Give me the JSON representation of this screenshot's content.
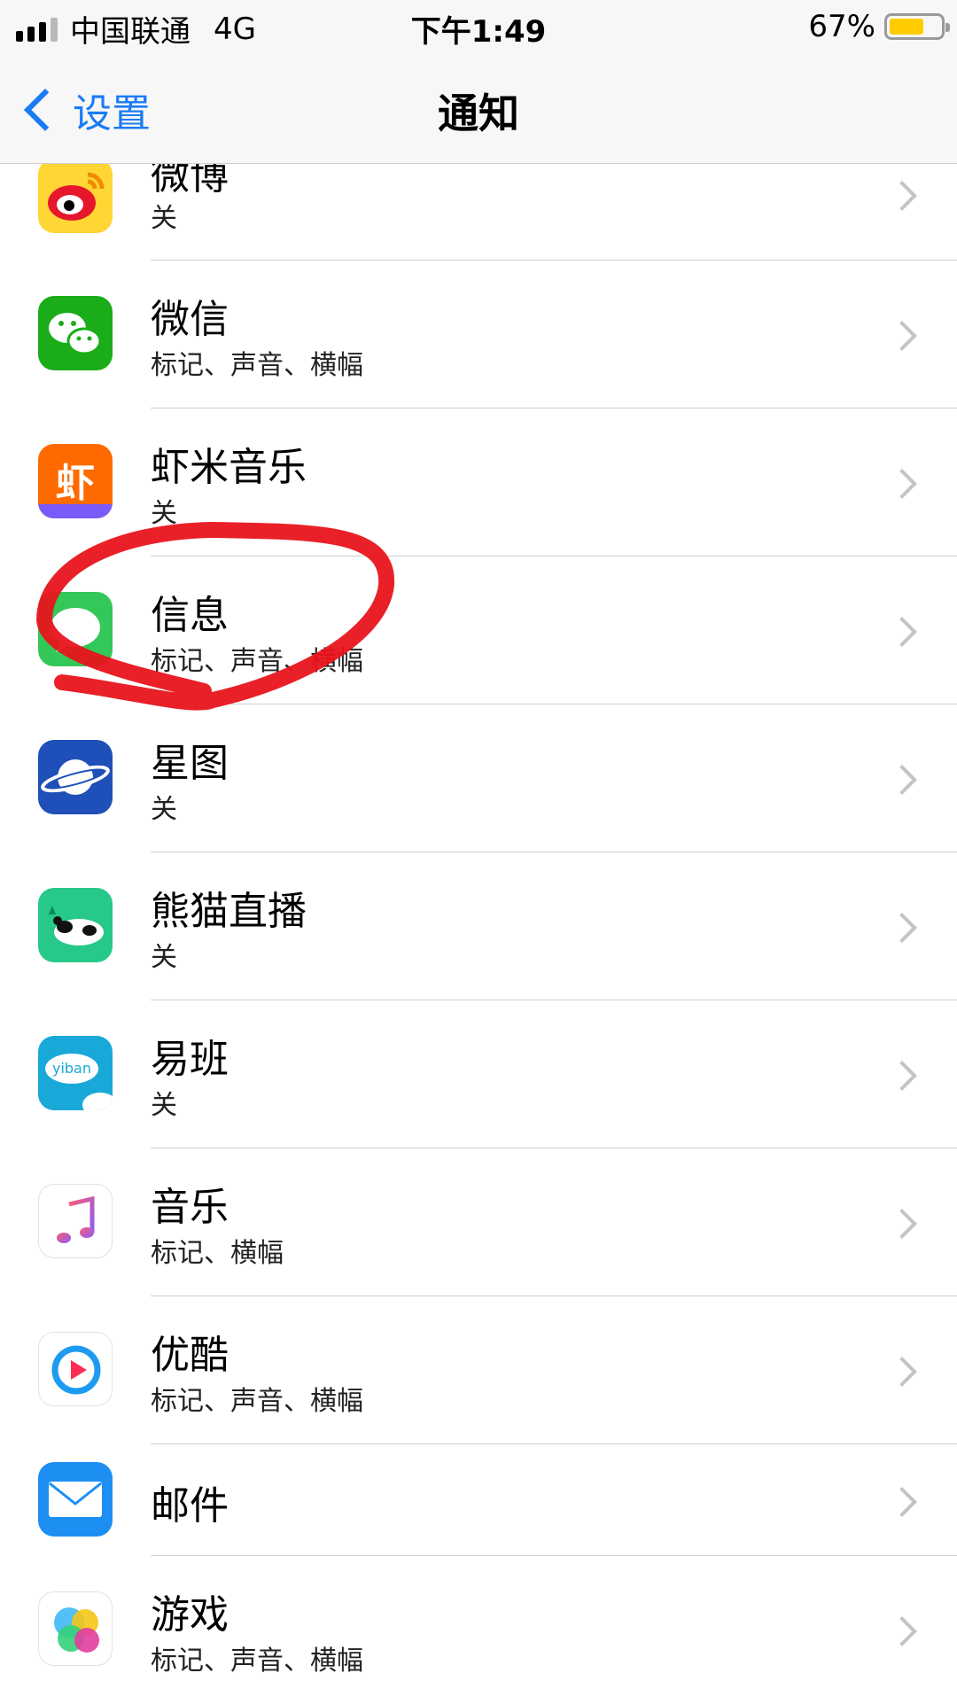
{
  "status_bar": {
    "carrier": "中国联通",
    "network": "4G",
    "time": "下午1:49",
    "battery_percent": "67%",
    "battery_level": 0.67,
    "battery_color": "#ffcc00"
  },
  "nav": {
    "back_label": "设置",
    "title": "通知",
    "accent_color": "#1a7cf5"
  },
  "apps": [
    {
      "name": "微博",
      "status": "关",
      "icon": "weibo-icon"
    },
    {
      "name": "微信",
      "status": "标记、声音、横幅",
      "icon": "wechat-icon"
    },
    {
      "name": "虾米音乐",
      "status": "关",
      "icon": "xiami-music-icon",
      "icon_text": "虾"
    },
    {
      "name": "信息",
      "status": "标记、声音、横幅",
      "icon": "messages-icon"
    },
    {
      "name": "星图",
      "status": "关",
      "icon": "star-map-icon"
    },
    {
      "name": "熊猫直播",
      "status": "关",
      "icon": "panda-live-icon"
    },
    {
      "name": "易班",
      "status": "关",
      "icon": "yiban-icon",
      "icon_text": "yiban"
    },
    {
      "name": "音乐",
      "status": "标记、横幅",
      "icon": "music-icon"
    },
    {
      "name": "优酷",
      "status": "标记、声音、横幅",
      "icon": "youku-icon"
    },
    {
      "name": "邮件",
      "status": "",
      "icon": "mail-icon"
    },
    {
      "name": "游戏",
      "status": "标记、声音、横幅",
      "icon": "game-center-icon"
    }
  ]
}
